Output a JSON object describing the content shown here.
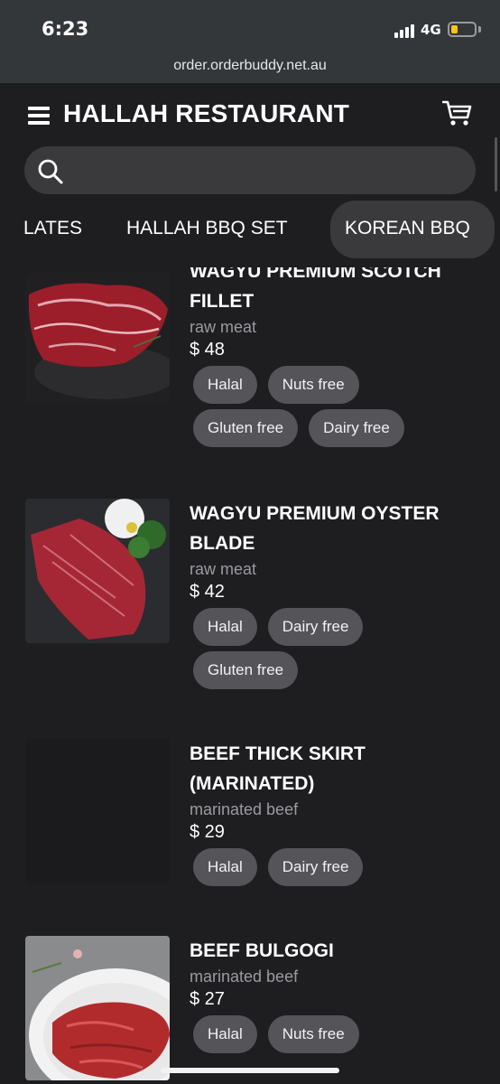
{
  "status_bar": {
    "time": "6:23",
    "network": "4G"
  },
  "browser": {
    "url": "order.orderbuddy.net.au"
  },
  "header": {
    "title": "HALLAH RESTAURANT"
  },
  "search": {
    "placeholder": ""
  },
  "tabs": [
    "LATES",
    "HALLAH BBQ SET",
    "KOREAN BBQ"
  ],
  "active_tab": "KOREAN BBQ",
  "items": [
    {
      "name": "WAGYU PREMIUM SCOTCH FILLET",
      "desc": "raw meat",
      "price": "$ 48",
      "tags": [
        "Halal",
        "Nuts free",
        "Gluten free",
        "Dairy free"
      ]
    },
    {
      "name": "WAGYU PREMIUM OYSTER BLADE",
      "desc": "raw meat",
      "price": "$ 42",
      "tags": [
        "Halal",
        "Dairy free",
        "Gluten free"
      ]
    },
    {
      "name": "BEEF THICK SKIRT (MARINATED)",
      "desc": "marinated beef",
      "price": "$ 29",
      "tags": [
        "Halal",
        "Dairy free"
      ]
    },
    {
      "name": "BEEF BULGOGI",
      "desc": "marinated beef",
      "price": "$ 27",
      "tags": [
        "Halal",
        "Nuts free"
      ]
    }
  ],
  "colors": {
    "background": "#1e1e21",
    "chrome": "#34373a",
    "tag": "#545459",
    "battery": "#f5c517"
  }
}
